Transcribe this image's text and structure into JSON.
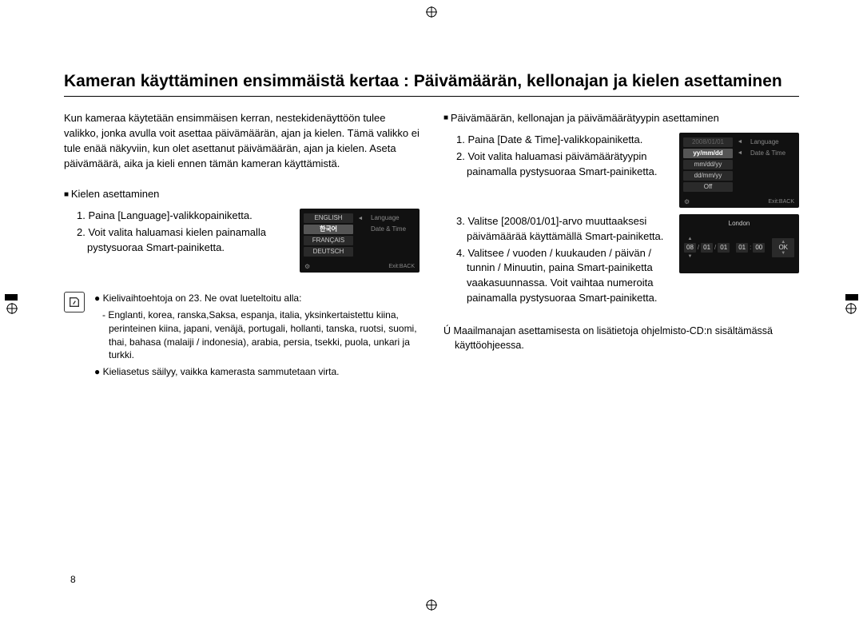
{
  "title": "Kameran käyttäminen ensimmäistä kertaa : Päivämäärän, kellonajan ja kielen asettaminen",
  "intro": "Kun kameraa käytetään ensimmäisen kerran, nestekidenäyttöön tulee valikko, jonka avulla voit asettaa päivämäärän, ajan ja kielen. Tämä valikko ei tule enää näkyviin, kun olet asettanut päivämäärän, ajan ja kielen. Aseta päivämäärä, aika ja kieli ennen tämän kameran käyttämistä.",
  "left": {
    "subhead": "Kielen asettaminen",
    "steps": [
      "1. Paina [Language]-valikkopainiketta.",
      "2. Voit valita haluamasi kielen painamalla pystysuoraa Smart-painiketta."
    ],
    "lcd": {
      "items": [
        "ENGLISH",
        "한국어",
        "FRANÇAIS",
        "DEUTSCH"
      ],
      "selected": 1,
      "right": [
        "Language",
        "Date & Time"
      ],
      "exit": "Exit:BACK"
    },
    "note1": "Kielivaihtoehtoja on 23. Ne ovat lueteltoitu alla:",
    "note1sub": "- Englanti, korea, ranska,Saksa, espanja, italia, yksinkertaistettu kiina, perinteinen kiina, japani, venäjä, portugali, hollanti, tanska, ruotsi, suomi, thai, bahasa (malaiji / indonesia), arabia, persia, tsekki, puola, unkari ja turkki.",
    "note2": "Kieliasetus säilyy, vaikka kamerasta sammutetaan virta."
  },
  "right": {
    "subhead": "Päivämäärän, kellonajan ja päivämäärätyypin asettaminen",
    "steps12": [
      "1. Paina [Date & Time]-valikkopainiketta.",
      "2. Voit valita haluamasi päivämäärätyypin painamalla pystysuoraa Smart-painiketta."
    ],
    "lcd1": {
      "items": [
        "2008/01/01",
        "yy/mm/dd",
        "mm/dd/yy",
        "dd/mm/yy",
        "Off"
      ],
      "selected": 1,
      "right": [
        "Language",
        "Date & Time"
      ],
      "exit": "Exit:BACK"
    },
    "steps34": [
      "3. Valitse [2008/01/01]-arvo muuttaaksesi päivämäärää käyttämällä Smart-painiketta.",
      "4. Valitsee / vuoden / kuukauden / päivän / tunnin / Minuutin, paina Smart-painiketta vaakasuunnassa. Voit vaihtaa numeroita painamalla pystysuoraa Smart-painiketta."
    ],
    "lcd2": {
      "city": "London",
      "cells": [
        "08",
        "01",
        "01",
        "01",
        "00"
      ],
      "ok": "OK"
    },
    "star": "Ú  Maailmanajan asettamisesta on lisätietoja ohjelmisto-CD:n sisältämässä käyttöohjeessa."
  },
  "pageNumber": "8"
}
